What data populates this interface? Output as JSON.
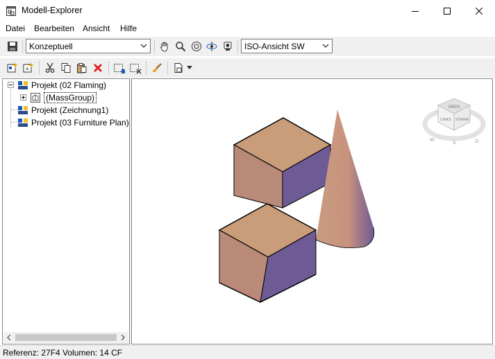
{
  "window": {
    "title": "Modell-Explorer",
    "app_icon": "model-explorer-icon",
    "controls": [
      "minimize-icon",
      "maximize-icon",
      "close-icon"
    ]
  },
  "menu": {
    "items": [
      {
        "label": "Datei"
      },
      {
        "label": "Bearbeiten"
      },
      {
        "label": "Ansicht"
      },
      {
        "label": "Hilfe"
      }
    ]
  },
  "toolbar1": {
    "save_icon": "save-icon",
    "visual_style": "Konzeptuell",
    "tools": [
      "pan-hand-icon",
      "zoom-icon",
      "orbit-icon",
      "free-orbit-icon",
      "camera-icon"
    ],
    "view": "ISO-Ansicht SW"
  },
  "toolbar2": {
    "tools": [
      "new-project-icon",
      "new-model-icon",
      "cut-icon",
      "copy-icon",
      "paste-icon",
      "delete-icon",
      "select-objects-icon",
      "deselect-icon",
      "style-brush-icon",
      "document-icon",
      "dropdown-arrow-icon"
    ]
  },
  "tree": {
    "items": [
      {
        "label": "Projekt (02 Flaming)",
        "icon": "project-icon"
      },
      {
        "label": "(MassGroup)",
        "icon": "massgroup-icon"
      },
      {
        "label": "Projekt (Zeichnung1)",
        "icon": "project-icon"
      },
      {
        "label": "Projekt (03 Furniture Plan)",
        "icon": "project-icon"
      }
    ]
  },
  "viewcube": {
    "faces": [
      "OBEN",
      "LINKS",
      "VORNE"
    ],
    "compass": [
      "W",
      "S",
      "O"
    ]
  },
  "colors": {
    "top_face": "#c99c7a",
    "left_face": "#b98a78",
    "right_face": "#6e5a94",
    "accent_blue": "#1e5bb8"
  },
  "status": {
    "text": "Referenz: 27F4  Volumen: 14 CF"
  }
}
